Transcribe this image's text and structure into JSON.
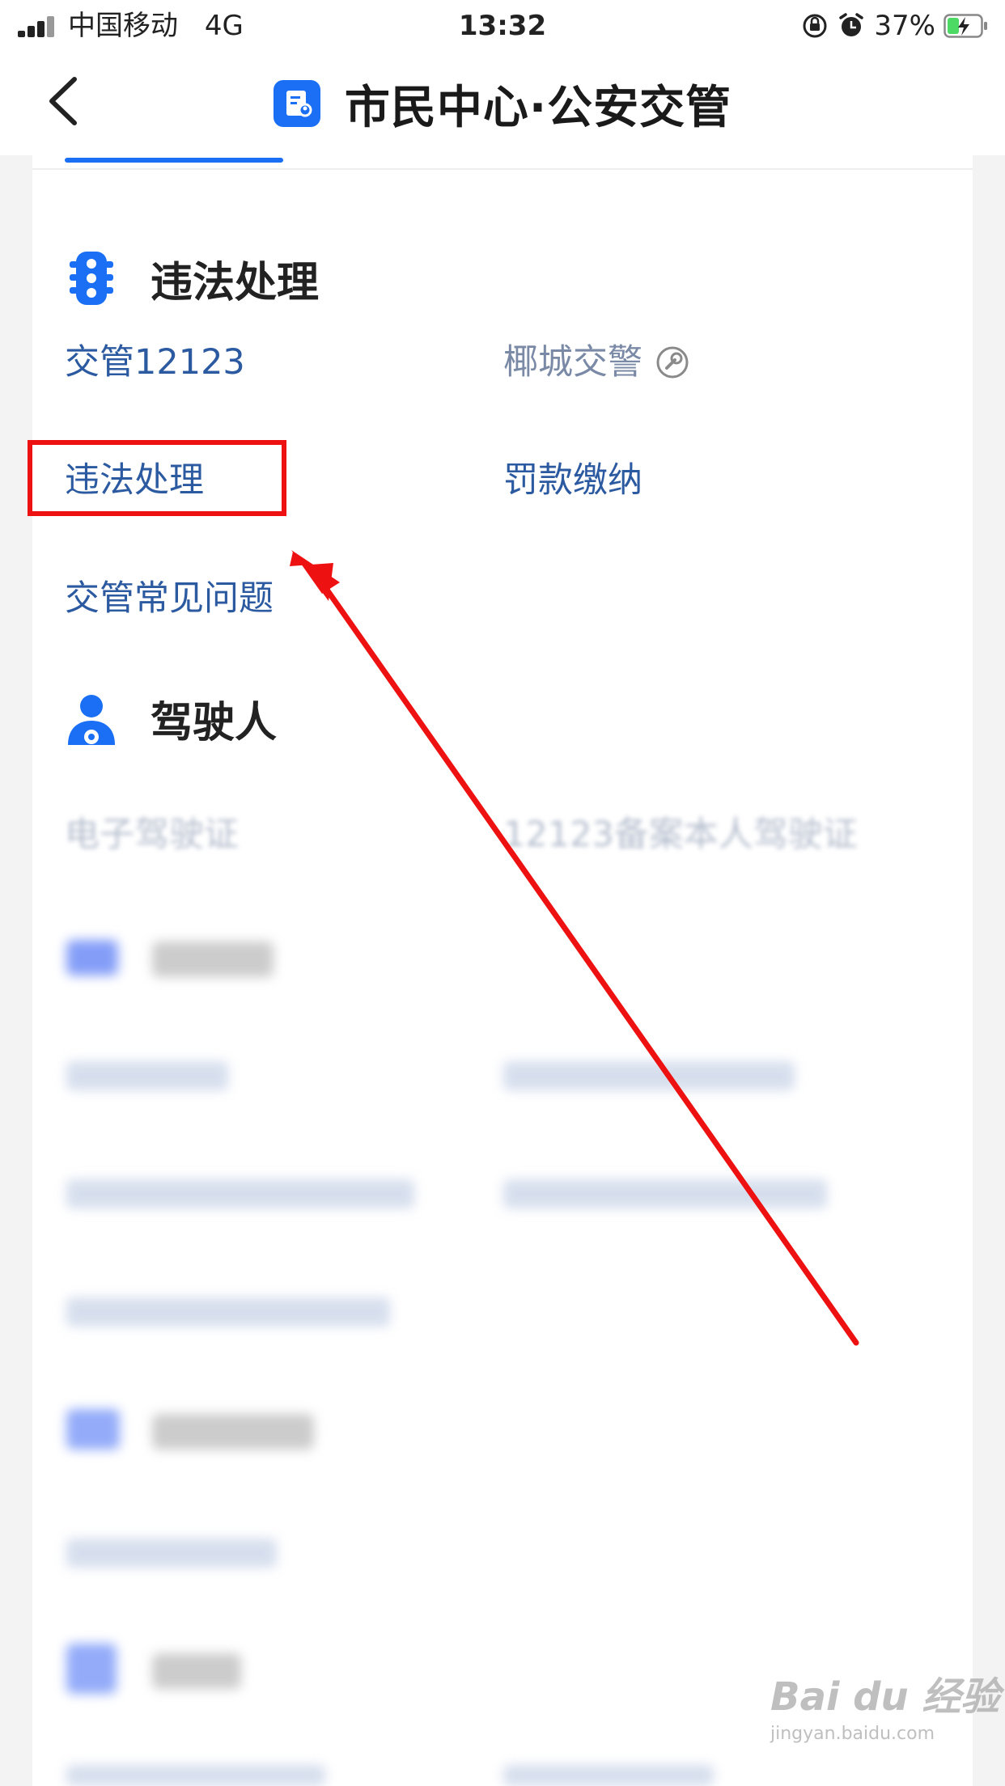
{
  "status_bar": {
    "carrier": "中国移动",
    "network": "4G",
    "time": "13:32",
    "battery_percent": "37%",
    "battery_level": 0.37
  },
  "nav": {
    "title": "市民中心·公安交管"
  },
  "sections": [
    {
      "title": "违法处理",
      "icon": "traffic-light-icon",
      "items": [
        {
          "label": "交管12123"
        },
        {
          "label": "椰城交警",
          "icon": "wrench-circle-icon"
        },
        {
          "label": "违法处理"
        },
        {
          "label": "罚款缴纳"
        },
        {
          "label": "交管常见问题"
        }
      ]
    },
    {
      "title": "驾驶人",
      "icon": "driver-person-icon",
      "items": [
        {
          "label": "电子驾驶证"
        },
        {
          "label": "12123备案本人驾驶证"
        }
      ]
    }
  ],
  "colors": {
    "accent": "#1b6ff5",
    "link": "#2c5aa0",
    "annotation": "#ee1111"
  },
  "watermark": {
    "brand": "Bai du 经验",
    "url": "jingyan.baidu.com"
  }
}
